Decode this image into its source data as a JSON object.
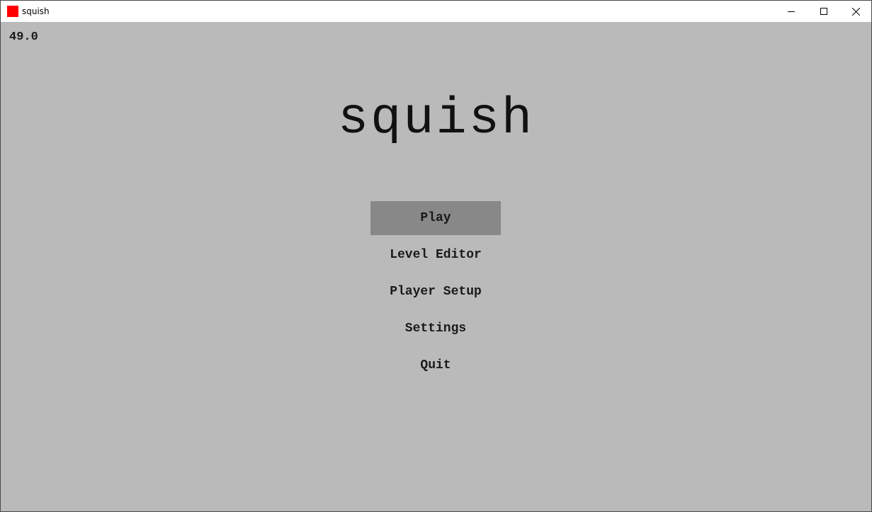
{
  "window": {
    "title": "squish",
    "icon": "red-square-icon",
    "icon_color": "#ff0000",
    "controls": [
      "minimize-icon",
      "maximize-icon",
      "close-icon"
    ]
  },
  "game": {
    "fps": "49.0",
    "title": "squish",
    "background_color": "#bababa",
    "selected_color": "#888888",
    "menu": [
      {
        "label": "Play",
        "selected": true
      },
      {
        "label": "Level Editor",
        "selected": false
      },
      {
        "label": "Player Setup",
        "selected": false
      },
      {
        "label": "Settings",
        "selected": false
      },
      {
        "label": "Quit",
        "selected": false
      }
    ]
  }
}
